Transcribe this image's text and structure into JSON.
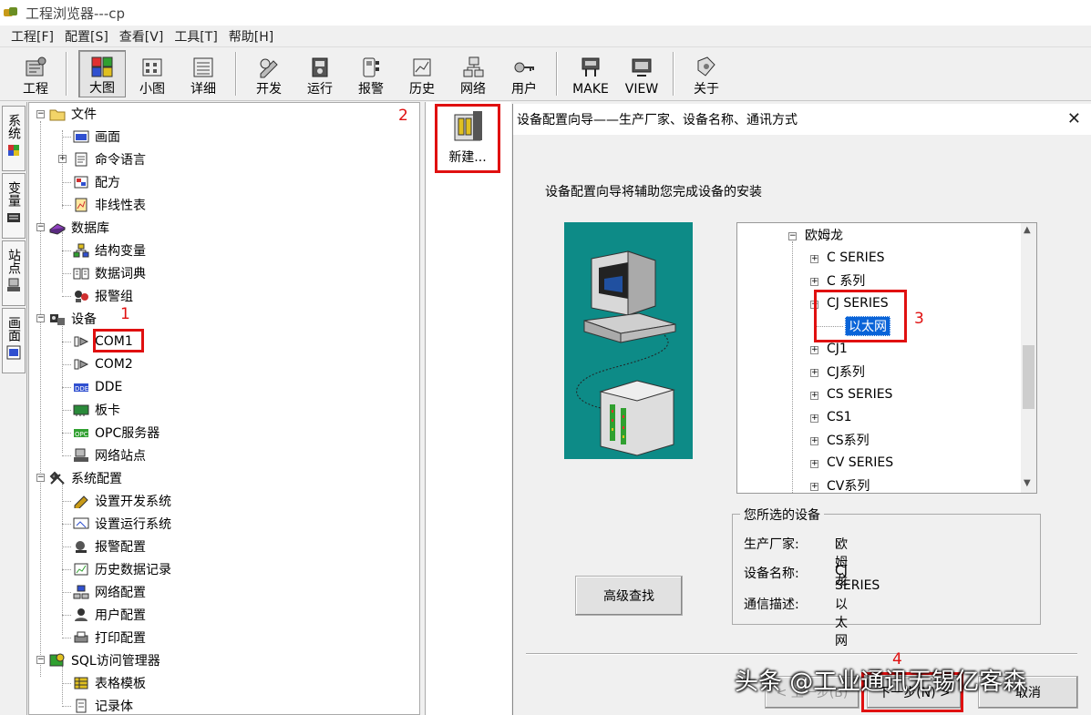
{
  "window": {
    "title": "工程浏览器---cp"
  },
  "menu": [
    "工程[F]",
    "配置[S]",
    "查看[V]",
    "工具[T]",
    "帮助[H]"
  ],
  "toolbar": {
    "project": "工程",
    "large": "大图",
    "small": "小图",
    "detail": "详细",
    "develop": "开发",
    "run": "运行",
    "alarm": "报警",
    "history": "历史",
    "network": "网络",
    "user": "用户",
    "make": "MAKE",
    "view": "VIEW",
    "about": "关于"
  },
  "side_tabs": [
    "系统",
    "变量",
    "站点",
    "画面"
  ],
  "tree": [
    "文件",
    "画面",
    "命令语言",
    "配方",
    "非线性表",
    "数据库",
    "结构变量",
    "数据词典",
    "报警组",
    "设备",
    "COM1",
    "COM2",
    "DDE",
    "板卡",
    "OPC服务器",
    "网络站点",
    "系统配置",
    "设置开发系统",
    "设置运行系统",
    "报警配置",
    "历史数据记录",
    "网络配置",
    "用户配置",
    "打印配置",
    "SQL访问管理器",
    "表格模板",
    "记录体"
  ],
  "new_item": "新建...",
  "steps": [
    "1",
    "2",
    "3",
    "4"
  ],
  "dialog": {
    "title": "设备配置向导——生产厂家、设备名称、通讯方式",
    "intro": "设备配置向导将辅助您完成设备的安装",
    "device_tree": [
      "欧姆龙",
      "C SERIES",
      "C 系列",
      "CJ SERIES",
      "以太网",
      "CJ1",
      "CJ系列",
      "CS SERIES",
      "CS1",
      "CS系列",
      "CV SERIES",
      "CV系列"
    ],
    "selected_group_title": "您所选的设备",
    "manufacturer_label": "生产厂家:",
    "manufacturer_value": "欧姆龙",
    "device_label": "设备名称:",
    "device_value": "CJ SERIES",
    "comm_label": "通信描述:",
    "comm_value": "以太网",
    "advanced_button": "高级查找",
    "prev_button": "< 上一步(B)",
    "next_button": "下一步(N) >",
    "cancel_button": "取消"
  },
  "watermark": "头条 @工业通讯无锡亿客森"
}
